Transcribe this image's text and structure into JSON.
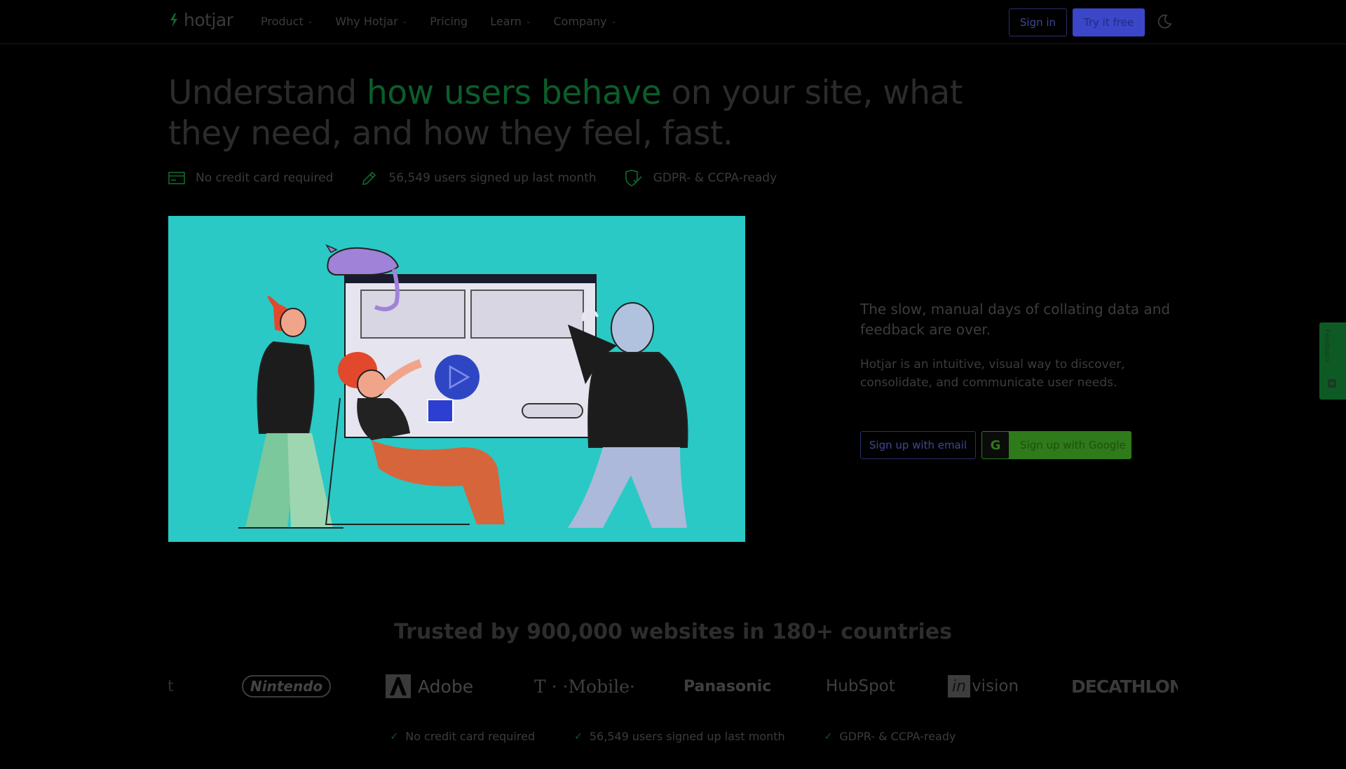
{
  "brand": {
    "logo_text": "hotjar"
  },
  "nav": {
    "items": [
      {
        "label": "Product",
        "has_menu": true
      },
      {
        "label": "Why Hotjar",
        "has_menu": true
      },
      {
        "label": "Pricing",
        "has_menu": false
      },
      {
        "label": "Learn",
        "has_menu": true
      },
      {
        "label": "Company",
        "has_menu": true
      }
    ],
    "sign_in": "Sign in",
    "try_free": "Try it free"
  },
  "hero": {
    "headline_pre": "Understand ",
    "headline_accent": "how users behave",
    "headline_post": " on your site, what they need, and how they feel, fast.",
    "perks": [
      {
        "icon": "credit-card-icon",
        "label": "No credit card required"
      },
      {
        "icon": "pencil-icon",
        "label": "56,549 users signed up last month"
      },
      {
        "icon": "shield-check-icon",
        "label": "GDPR- & CCPA-ready"
      }
    ],
    "pitch": "The slow, manual days of collating data and feedback are over.",
    "description": "Hotjar is an intuitive, visual way to discover, consolidate, and communicate user needs.",
    "signup_email": "Sign up with email",
    "signup_google": "Sign up with Google",
    "google_glyph": "G"
  },
  "feedback_tab": {
    "label": "Feedback"
  },
  "trusted": {
    "title": "Trusted by 900,000 websites in 180+ countries",
    "logos": [
      "Nintendo",
      "Adobe",
      "T · ·Mobile·",
      "Panasonic",
      "HubSpot",
      "in",
      "vision",
      "DECATHLON"
    ],
    "bottom_perks": [
      "No credit card required",
      "56,549 users signed up last month",
      "GDPR- & CCPA-ready"
    ]
  },
  "colors": {
    "accent_green": "#0b5d2b",
    "primary_blue": "#3b46c8",
    "illustration_bg": "#2ac9c5",
    "google_green": "#2f7a1a"
  }
}
